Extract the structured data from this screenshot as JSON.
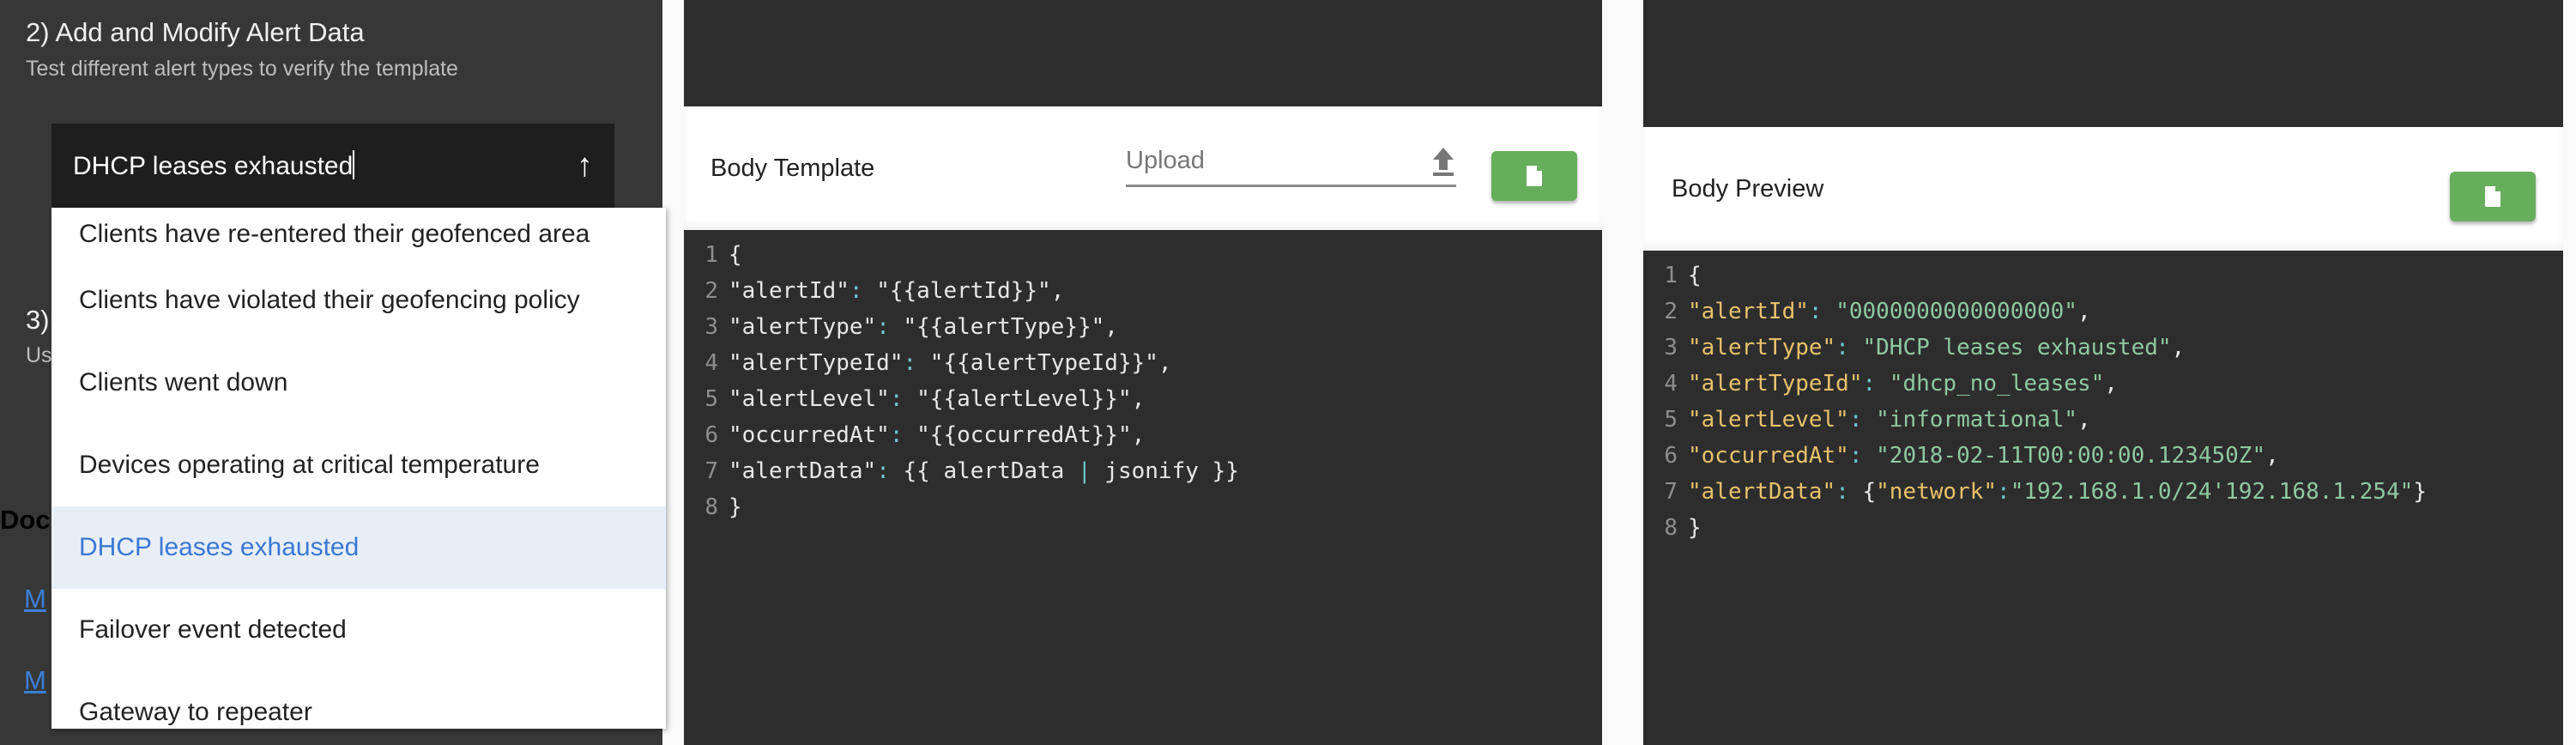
{
  "left": {
    "step2_title": "2) Add and Modify Alert Data",
    "step2_subtitle": "Test different alert types to verify the template",
    "step3_title": "3)",
    "step3_subtitle": "Us",
    "docs_heading": "Doc",
    "links": [
      "M",
      "M"
    ],
    "alert_select": {
      "value": "DHCP leases exhausted",
      "options": [
        "Clients have re-entered their geofenced area",
        "Clients have violated their geofencing policy",
        "Clients went down",
        "Devices operating at critical temperature",
        "DHCP leases exhausted",
        "Failover event detected",
        "Gateway to repeater"
      ],
      "selected_index": 4
    }
  },
  "template": {
    "title": "Body Template",
    "upload_placeholder": "Upload",
    "lines": [
      [
        [
          "plain",
          "{"
        ]
      ],
      [
        [
          "plain",
          "\"alertId\""
        ],
        [
          "col",
          ":"
        ],
        [
          "plain",
          " \"{{alertId}}\","
        ]
      ],
      [
        [
          "plain",
          "\"alertType\""
        ],
        [
          "col",
          ":"
        ],
        [
          "plain",
          " \"{{alertType}}\","
        ]
      ],
      [
        [
          "plain",
          "\"alertTypeId\""
        ],
        [
          "col",
          ":"
        ],
        [
          "plain",
          " \"{{alertTypeId}}\","
        ]
      ],
      [
        [
          "plain",
          "\"alertLevel\""
        ],
        [
          "col",
          ":"
        ],
        [
          "plain",
          " \"{{alertLevel}}\","
        ]
      ],
      [
        [
          "plain",
          "\"occurredAt\""
        ],
        [
          "col",
          ":"
        ],
        [
          "plain",
          " \"{{occurredAt}}\","
        ]
      ],
      [
        [
          "plain",
          "\"alertData\""
        ],
        [
          "col",
          ":"
        ],
        [
          "plain",
          " {{ alertData "
        ],
        [
          "col",
          "|"
        ],
        [
          "plain",
          " jsonify }}"
        ]
      ],
      [
        [
          "plain",
          "}"
        ]
      ]
    ]
  },
  "preview": {
    "title": "Body Preview",
    "lines": [
      [
        [
          "plain",
          "{"
        ]
      ],
      [
        [
          "key",
          "\"alertId\""
        ],
        [
          "col",
          ":"
        ],
        [
          "plain",
          " "
        ],
        [
          "str",
          "\"0000000000000000\""
        ],
        [
          "plain",
          ","
        ]
      ],
      [
        [
          "key",
          "\"alertType\""
        ],
        [
          "col",
          ":"
        ],
        [
          "plain",
          " "
        ],
        [
          "str",
          "\"DHCP leases exhausted\""
        ],
        [
          "plain",
          ","
        ]
      ],
      [
        [
          "key",
          "\"alertTypeId\""
        ],
        [
          "col",
          ":"
        ],
        [
          "plain",
          " "
        ],
        [
          "str",
          "\"dhcp_no_leases\""
        ],
        [
          "plain",
          ","
        ]
      ],
      [
        [
          "key",
          "\"alertLevel\""
        ],
        [
          "col",
          ":"
        ],
        [
          "plain",
          " "
        ],
        [
          "str",
          "\"informational\""
        ],
        [
          "plain",
          ","
        ]
      ],
      [
        [
          "key",
          "\"occurredAt\""
        ],
        [
          "col",
          ":"
        ],
        [
          "plain",
          " "
        ],
        [
          "str",
          "\"2018-02-11T00:00:00.123450Z\""
        ],
        [
          "plain",
          ","
        ]
      ],
      [
        [
          "key",
          "\"alertData\""
        ],
        [
          "col",
          ":"
        ],
        [
          "plain",
          " {"
        ],
        [
          "key",
          "\"network\""
        ],
        [
          "col",
          ":"
        ],
        [
          "str",
          "\"192.168.1.0/24'192.168.1.254\""
        ],
        [
          "plain",
          "}"
        ]
      ],
      [
        [
          "plain",
          "}"
        ]
      ]
    ]
  },
  "colors": {
    "accent_green": "#67ae5c",
    "key": "#e8c16a",
    "string": "#8ec9a0",
    "highlight": "#3a78d3"
  }
}
